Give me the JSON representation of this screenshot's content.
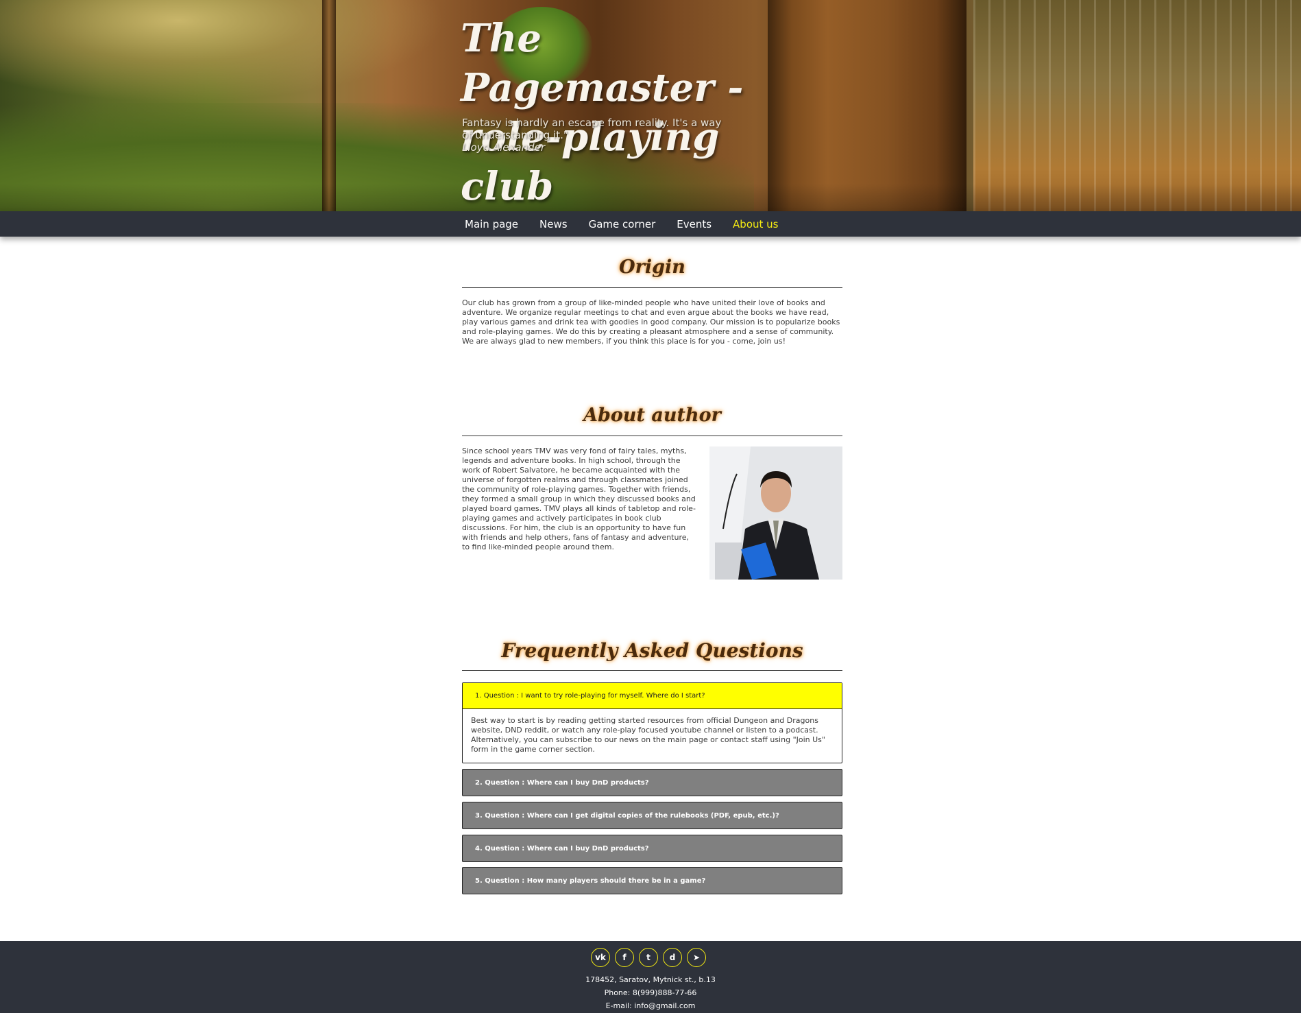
{
  "header": {
    "title": "The Pagemaster - role-playing club",
    "quote": "Fantasy is hardly an escape from reality. It's a way of understanding it.\"",
    "quote_author": "Lloyd Alexander"
  },
  "nav": {
    "items": [
      {
        "label": "Main page"
      },
      {
        "label": "News"
      },
      {
        "label": "Game corner"
      },
      {
        "label": "Events"
      },
      {
        "label": "About us"
      }
    ],
    "active": "About us"
  },
  "origin": {
    "title": "Origin",
    "text": "Our club has grown from a group of like-minded people who have united their love of books and adventure. We organize regular meetings to chat and even argue about the books we have read, play various games and drink tea with goodies in good company. Our mission is to popularize books and role-playing games. We do this by creating a pleasant atmosphere and a sense of community. We are always glad to new members, if you think this place is for you - come, join us!"
  },
  "author": {
    "title": "About author",
    "text": "Since school years TMV was very fond of fairy tales, myths, legends and adventure books. In high school, through the work of Robert Salvatore, he became acquainted with the universe of forgotten realms and through classmates joined the community of role-playing games. Together with friends, they formed a small group in which they discussed books and played board games. TMV plays all kinds of tabletop and role-playing games and actively participates in book club discussions. For him, the club is an opportunity to have fun with friends and help others, fans of fantasy and adventure, to find like-minded people around them."
  },
  "faq": {
    "title": "Frequently Asked Questions",
    "items": [
      {
        "question": "1. Question : I want to try role-playing for myself. Where do I start?",
        "answer": "Best way to start is by reading getting started resources from official Dungeon and Dragons website, DND reddit, or watch any role-play focused youtube channel or listen to a podcast. Alternatively, you can subscribe to our news on the main page or contact staff using \"Join Us\" form in the game corner section."
      },
      {
        "question": "2. Question : Where can I buy DnD products?"
      },
      {
        "question": "3. Question : Where can I get digital copies of the rulebooks (PDF, epub, etc.)?"
      },
      {
        "question": "4. Question : Where can I buy DnD products?"
      },
      {
        "question": "5. Question : How many players should there be in a game?"
      }
    ]
  },
  "footer": {
    "socials": [
      {
        "icon": "vk-icon",
        "glyph": "vk"
      },
      {
        "icon": "facebook-icon",
        "glyph": "f"
      },
      {
        "icon": "twitter-icon",
        "glyph": "t"
      },
      {
        "icon": "discord-icon",
        "glyph": "d"
      },
      {
        "icon": "telegram-icon",
        "glyph": "➤"
      }
    ],
    "address": "178452, Saratov, Mytnick st., b.13",
    "phone": "Phone: 8(999)888-77-66",
    "email": "E-mail: info@gmail.com"
  },
  "colors": {
    "nav_bg": "#2e323b",
    "accent_yellow": "#f4ea12",
    "faq_collapsed": "#808080",
    "faq_open": "#ffff00"
  }
}
